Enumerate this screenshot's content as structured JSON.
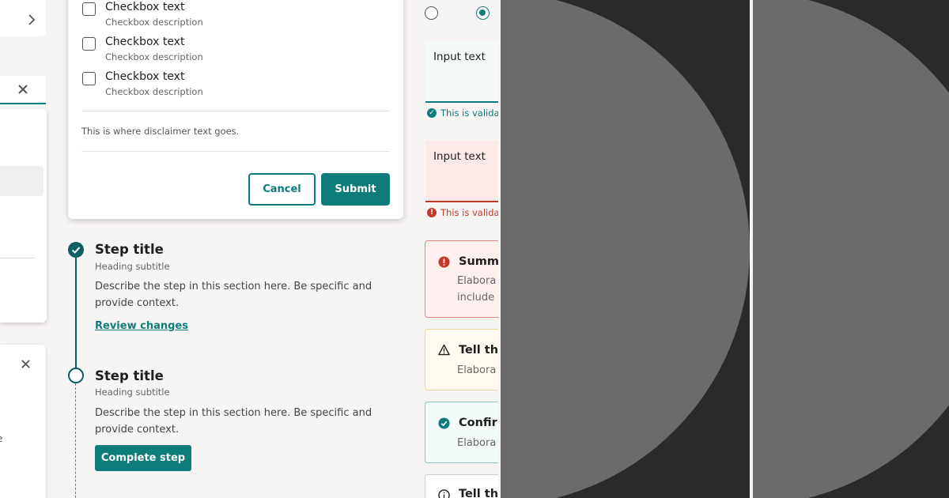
{
  "colors": {
    "accent": "#0e7c7b",
    "stepper": "#0d5f61",
    "error": "#c0392b",
    "warning_border": "#ecd79a",
    "background": "#f7f4f4",
    "dark_panel": "#2a2a2a",
    "circle": "#6b6b6b"
  },
  "checkbox_modal": {
    "items": [
      {
        "label": "Checkbox text",
        "description": "Checkbox description"
      },
      {
        "label": "Checkbox text",
        "description": "Checkbox description"
      },
      {
        "label": "Checkbox text",
        "description": "Checkbox description"
      }
    ],
    "disclaimer": "This is where disclaimer text goes.",
    "cancel_label": "Cancel",
    "submit_label": "Submit"
  },
  "stepper": {
    "steps": [
      {
        "title": "Step title",
        "subtitle": "Heading subtitle",
        "description": "Describe the step in this section here. Be specific and provide context.",
        "action": "Review changes",
        "state": "complete"
      },
      {
        "title": "Step title",
        "subtitle": "Heading subtitle",
        "description": "Describe the step in this section here. Be specific and provide context.",
        "action": "Complete step",
        "state": "current"
      }
    ]
  },
  "left_fragment": {
    "text": "e"
  },
  "inputs": {
    "valid": {
      "value": "Input text",
      "hint": "This is valida"
    },
    "invalid": {
      "value": "Input text",
      "hint": "This is valida"
    }
  },
  "alerts": [
    {
      "type": "error",
      "icon": "error-icon",
      "title": "Summa",
      "body": [
        "Elabora",
        "include"
      ]
    },
    {
      "type": "warning",
      "icon": "warning-icon",
      "title": "Tell the",
      "body": [
        "Elabora"
      ]
    },
    {
      "type": "success",
      "icon": "check-circle-icon",
      "title": "Confirr",
      "body": [
        "Elabora"
      ]
    },
    {
      "type": "info",
      "icon": "info-icon",
      "title": "Tell the",
      "body": []
    }
  ]
}
